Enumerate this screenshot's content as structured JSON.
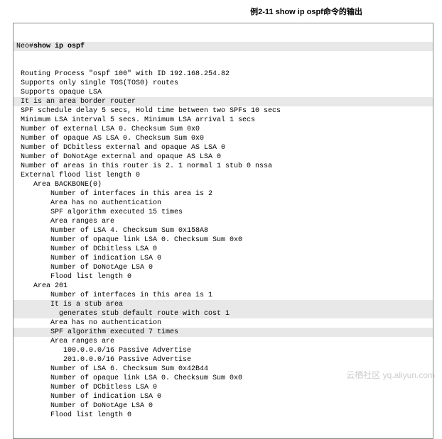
{
  "title": "例2-11 show ip ospf命令的输出",
  "prompt_prefix": "Neo#",
  "command": "show ip ospf",
  "lines": [
    {
      "text": " Routing Process \"ospf 100\" with ID 192.168.254.82",
      "hl": false
    },
    {
      "text": " Supports only single TOS(TOS0) routes",
      "hl": false
    },
    {
      "text": " Supports opaque LSA",
      "hl": false
    },
    {
      "text": " It is an area border router",
      "hl": true
    },
    {
      "text": " SPF schedule delay 5 secs, Hold time between two SPFs 10 secs",
      "hl": false
    },
    {
      "text": " Minimum LSA interval 5 secs. Minimum LSA arrival 1 secs",
      "hl": false
    },
    {
      "text": " Number of external LSA 0. Checksum Sum 0x0",
      "hl": false
    },
    {
      "text": " Number of opaque AS LSA 0. Checksum Sum 0x0",
      "hl": false
    },
    {
      "text": " Number of DCbitless external and opaque AS LSA 0",
      "hl": false
    },
    {
      "text": " Number of DoNotAge external and opaque AS LSA 0",
      "hl": false
    },
    {
      "text": " Number of areas in this router is 2. 1 normal 1 stub 0 nssa",
      "hl": false
    },
    {
      "text": " External flood list length 0",
      "hl": false
    },
    {
      "text": "    Area BACKBONE(0)",
      "hl": false
    },
    {
      "text": "        Number of interfaces in this area is 2",
      "hl": false
    },
    {
      "text": "        Area has no authentication",
      "hl": false
    },
    {
      "text": "        SPF algorithm executed 15 times",
      "hl": false
    },
    {
      "text": "        Area ranges are",
      "hl": false
    },
    {
      "text": "        Number of LSA 4. Checksum Sum 0x158A8",
      "hl": false
    },
    {
      "text": "        Number of opaque link LSA 0. Checksum Sum 0x0",
      "hl": false
    },
    {
      "text": "        Number of DCbitless LSA 0",
      "hl": false
    },
    {
      "text": "        Number of indication LSA 0",
      "hl": false
    },
    {
      "text": "        Number of DoNotAge LSA 0",
      "hl": false
    },
    {
      "text": "        Flood list length 0",
      "hl": false
    },
    {
      "text": "    Area 201",
      "hl": false
    },
    {
      "text": "        Number of interfaces in this area is 1",
      "hl": false
    },
    {
      "text": "        It is a stub area",
      "hl": true
    },
    {
      "text": "          generates stub default route with cost 1",
      "hl": true
    },
    {
      "text": "        Area has no authentication",
      "hl": false
    },
    {
      "text": "        SPF algorithm executed 7 times",
      "hl": true
    },
    {
      "text": "        Area ranges are",
      "hl": false
    },
    {
      "text": "           100.0.0.0/16 Passive Advertise",
      "hl": false
    },
    {
      "text": "           201.0.0.0/16 Passive Advertise",
      "hl": false
    },
    {
      "text": "        Number of LSA 6. Checksum Sum 0x42B44",
      "hl": false
    },
    {
      "text": "        Number of opaque link LSA 0. Checksum Sum 0x0",
      "hl": false
    },
    {
      "text": "        Number of DCbitless LSA 0",
      "hl": false
    },
    {
      "text": "        Number of indication LSA 0",
      "hl": false
    },
    {
      "text": "        Number of DoNotAge LSA 0",
      "hl": false
    },
    {
      "text": "        Flood list length 0",
      "hl": false
    }
  ],
  "watermark": "云栖社区 yq.aliyun.com"
}
